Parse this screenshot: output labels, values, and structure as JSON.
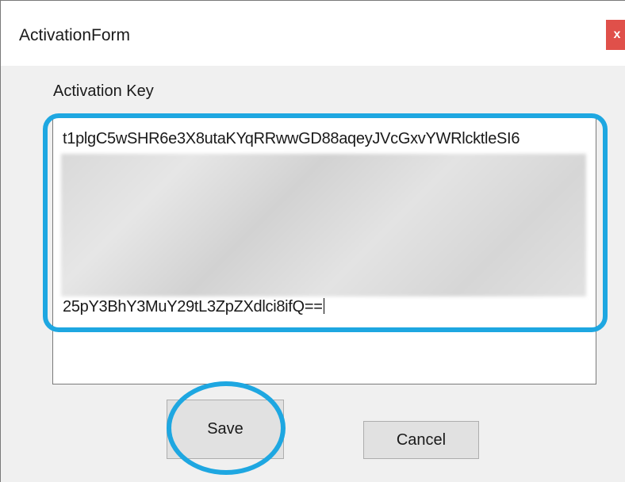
{
  "window": {
    "title": "ActivationForm",
    "close_label": "x"
  },
  "form": {
    "activation_label": "Activation Key",
    "key_first_line": "t1plgC5wSHR6e3X8utaKYqRRwwGD88aqeyJVcGxvYWRlcktleSI6",
    "key_last_line": "25pY3BhY3MuY29tL3ZpZXdlci8ifQ==",
    "save_label": "Save",
    "cancel_label": "Cancel"
  },
  "colors": {
    "highlight": "#1ea7e1",
    "close_button": "#e0504a"
  }
}
